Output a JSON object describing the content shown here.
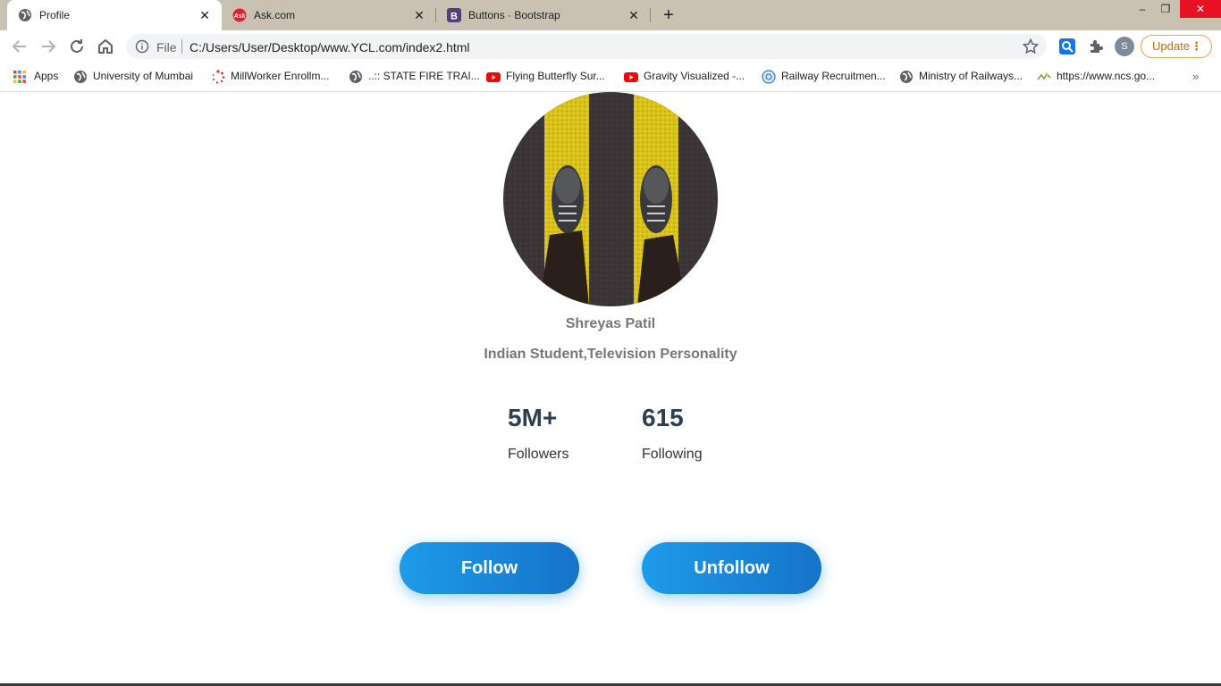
{
  "browser": {
    "tabs": [
      {
        "title": "Profile",
        "active": true
      },
      {
        "title": "Ask.com",
        "active": false
      },
      {
        "title": "Buttons · Bootstrap",
        "active": false
      }
    ],
    "new_tab_label": "+",
    "window_controls": {
      "minimize": "–",
      "restore": "❐",
      "close": "✕"
    },
    "address_bar": {
      "scheme_label": "File",
      "url": "C:/Users/User/Desktop/www.YCL.com/index2.html"
    },
    "profile_initial": "S",
    "update_label": "Update",
    "bookmarks": [
      {
        "label": "Apps",
        "icon": "apps-grid-icon"
      },
      {
        "label": "University of Mumbai",
        "icon": "globe-icon"
      },
      {
        "label": "MillWorker Enrollm...",
        "icon": "spinner-dots-icon"
      },
      {
        "label": "..:: STATE FIRE TRAI...",
        "icon": "globe-icon"
      },
      {
        "label": "Flying Butterfly Sur...",
        "icon": "youtube-icon"
      },
      {
        "label": "Gravity Visualized -...",
        "icon": "youtube-icon"
      },
      {
        "label": "Railway Recruitmen...",
        "icon": "emblem-icon"
      },
      {
        "label": "Ministry of Railways...",
        "icon": "globe-icon"
      },
      {
        "label": "https://www.ncs.go...",
        "icon": "ncs-icon"
      }
    ],
    "bookmarks_overflow": "»"
  },
  "profile": {
    "name": "Shreyas Patil",
    "bio": "Indian Student,Television Personality",
    "stats": [
      {
        "value": "5M+",
        "label": "Followers"
      },
      {
        "value": "615",
        "label": "Following"
      }
    ],
    "follow_label": "Follow",
    "unfollow_label": "Unfollow"
  },
  "colors": {
    "tabstrip": "#c9c2b2",
    "button_gradient_start": "#1e9bea",
    "button_gradient_end": "#1673c8",
    "stat_value": "#2c3e50",
    "name_text": "#777777",
    "update_accent": "#c56b11",
    "close_red": "#e81123"
  }
}
